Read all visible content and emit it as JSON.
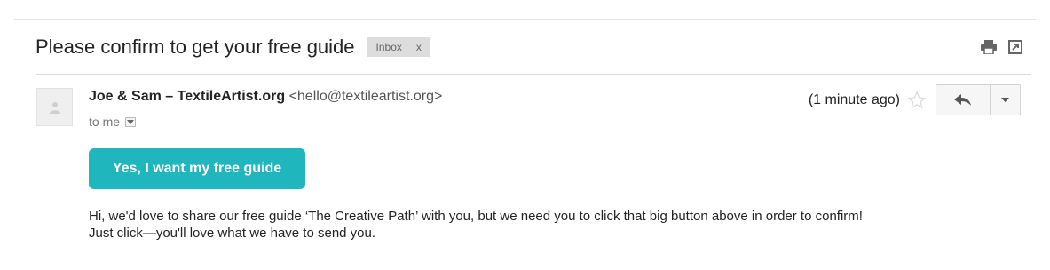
{
  "subject": {
    "title": "Please confirm to get your free guide",
    "label": "Inbox",
    "label_remove": "x"
  },
  "toolbar": {
    "icons": [
      "print-icon",
      "new-window-icon"
    ]
  },
  "message": {
    "sender_name": "Joe & Sam – TextileArtist.org",
    "sender_email": "<hello@textileartist.org>",
    "to": "to me",
    "time": "(1 minute ago)"
  },
  "cta": {
    "label": "Yes, I want my free guide",
    "color": "#1fb6bd"
  },
  "body": {
    "line1": "Hi, we'd love to share our free guide ‘The Creative Path’ with you, but we need you to click that big button above in order to confirm!",
    "line2": "Just click—you'll love what we have to send you."
  }
}
